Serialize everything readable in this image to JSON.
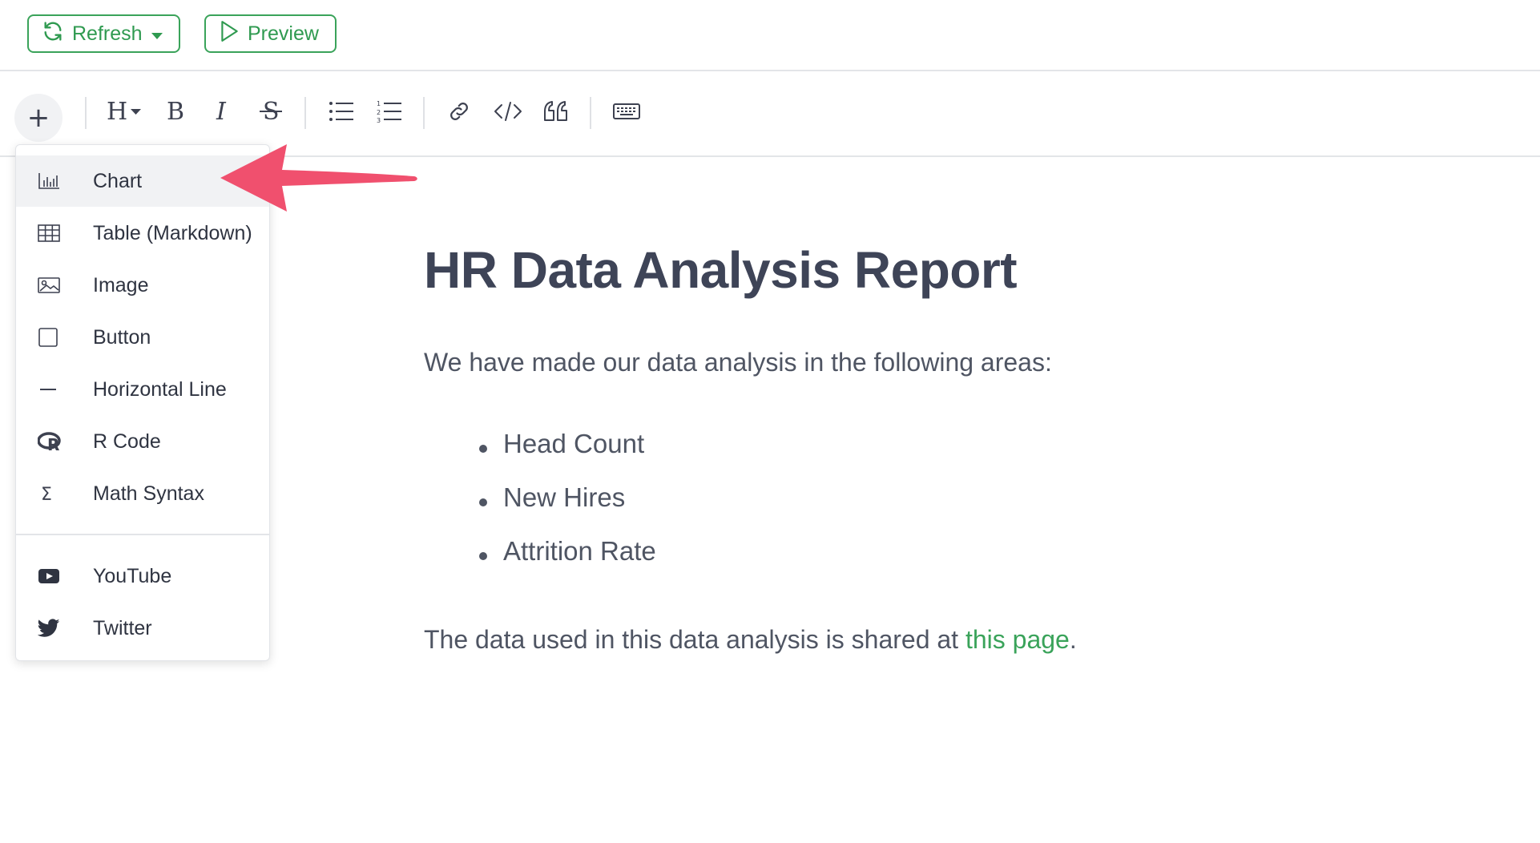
{
  "topbar": {
    "refresh_label": "Refresh",
    "preview_label": "Preview"
  },
  "toolbar": {
    "icons": [
      "plus-icon",
      "heading-icon",
      "bold-icon",
      "italic-icon",
      "strikethrough-icon",
      "bullet-list-icon",
      "numbered-list-icon",
      "link-icon",
      "code-icon",
      "quote-icon",
      "keyboard-icon"
    ]
  },
  "menu": {
    "items": [
      {
        "label": "Chart",
        "icon": "chart-icon"
      },
      {
        "label": "Table (Markdown)",
        "icon": "table-icon"
      },
      {
        "label": "Image",
        "icon": "image-icon"
      },
      {
        "label": "Button",
        "icon": "button-icon"
      },
      {
        "label": "Horizontal Line",
        "icon": "horizontal-line-icon"
      },
      {
        "label": "R Code",
        "icon": "r-logo-icon"
      },
      {
        "label": "Math Syntax",
        "icon": "sigma-icon"
      },
      {
        "label": "YouTube",
        "icon": "youtube-icon"
      },
      {
        "label": "Twitter",
        "icon": "twitter-icon"
      }
    ]
  },
  "document": {
    "title": "HR Data Analysis Report",
    "intro": "We have made our data analysis in the following areas:",
    "bullets": [
      "Head Count",
      "New Hires",
      "Attrition Rate"
    ],
    "outro_prefix": "The data used in this data analysis is shared at ",
    "outro_link": "this page",
    "outro_suffix": "."
  },
  "colors": {
    "accent_green": "#3aa35a",
    "annotation_arrow": "#f0506e",
    "heading": "#3e4457"
  }
}
